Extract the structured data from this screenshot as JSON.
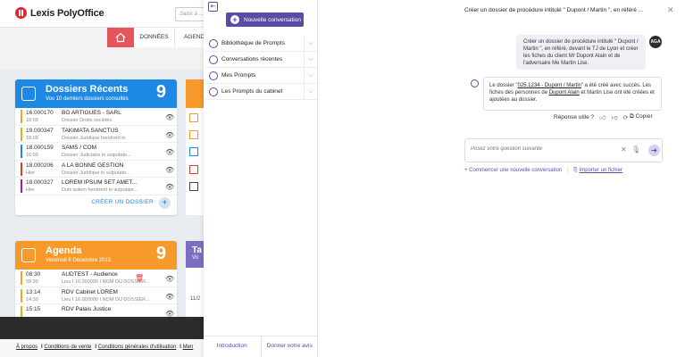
{
  "app": {
    "logo_text": "Lexis PolyOffice",
    "search_placeholder": "Saisir à ...",
    "nav_tabs": [
      "DONNÉES",
      "AGEND"
    ]
  },
  "dossiers_card": {
    "title": "Dossiers Récents",
    "subtitle": "Vos 10 derniers dossiers consultés",
    "count": "9",
    "rows": [
      {
        "ref": "16.000170",
        "time": "18:09",
        "name": "BG ARTIGUES - SARL",
        "desc": "Dossier Droits sociétés",
        "color": "#f5a623"
      },
      {
        "ref": "19.000347",
        "time": "18:09",
        "name": "TAKIMATA SANCTUS",
        "desc": "Dossier Juridique hendrerit in",
        "color": "#f5a623"
      },
      {
        "ref": "18.000159",
        "time": "16:09",
        "name": "SAMS / COM",
        "desc": "Dossier Judiciaire in vulputate...",
        "color": "#1e88e5"
      },
      {
        "ref": "18.000206",
        "time": "Hier",
        "name": "A LA BONNE GESTION",
        "desc": "Dossier Juridique in vulputate...",
        "color": "#e53935"
      },
      {
        "ref": "18.000327",
        "time": "Hier",
        "name": "LOREM IPSUM SET AMET...",
        "desc": "Duis autem hendrerit in vulputate...",
        "color": "#8e24aa"
      }
    ],
    "footer_link": "CRÉER UN DOSSIER"
  },
  "agenda_card": {
    "title": "Agenda",
    "subtitle": "Vendredi 6 Décembre 2019",
    "count": "9",
    "rows": [
      {
        "ref": "08:30",
        "time": "09:30",
        "name": "AUDTEST - Audience",
        "desc": "Lieu  I  16.000000  I  NOM DU DOSSIER...",
        "color": "#f5a623"
      },
      {
        "ref": "13:14",
        "time": "14:30",
        "name": "RDV Cabinet LOREM",
        "desc": "Lieu  I  16.000000  I  NOM DU DOSSIER...",
        "color": "#f5a623"
      },
      {
        "ref": "15:15",
        "time": "",
        "name": "RDV Palais Justice",
        "desc": "",
        "color": "#f5a623"
      }
    ]
  },
  "side_cards": {
    "tasks_title": "Ta",
    "tasks_sub": "Vo",
    "tasks_row": "11/2"
  },
  "footer_links": [
    "À propos",
    "Conditions de vente",
    "Conditions générales d'utilisation",
    "Men"
  ],
  "left_panel": {
    "new_conversation": "Nouvelle conversation",
    "menu": [
      {
        "label": "Bibliothèque de Prompts"
      },
      {
        "label": "Conversations récentes"
      },
      {
        "label": "Mes Prompts"
      },
      {
        "label": "Les Prompts du cabinet"
      }
    ],
    "bottom_tabs": [
      "Introduction",
      "Donner votre avis"
    ]
  },
  "chat": {
    "title": "Créer un dossier de procédure intitulé \" Dupont / Martin \", en référé ...",
    "user_message": "Créer un dossier de procédure intitulé \" Dupont / Martin \", en référé, devant le TJ de Lyon et créer les fiches du client Mr Dupont Alain et de l'adversaire Me Martin Lise.",
    "avatar": "AGA",
    "bot_prefix": "Le dossier \"",
    "bot_link": "025.1234 - Dupont / Martin",
    "bot_mid": "\" a été créé avec succès. Les fiches des personnes de",
    "bot_link2": "Dupont Alain",
    "bot_suffix": "et Martin Lise ont été créées et ajoutées au dossier.",
    "feedback_label": "Réponse utile ?",
    "copy_label": "Copier",
    "input_placeholder": "Posez votre question suivante",
    "new_conv_link": "+ Commencer une nouvelle conversation",
    "import_link": "Importer un fichier"
  },
  "colors": {
    "brand_purple": "#5a4ba6",
    "dossiers_blue": "#1e88e5",
    "agenda_orange": "#f79a2b",
    "home_red": "#e7555c"
  }
}
